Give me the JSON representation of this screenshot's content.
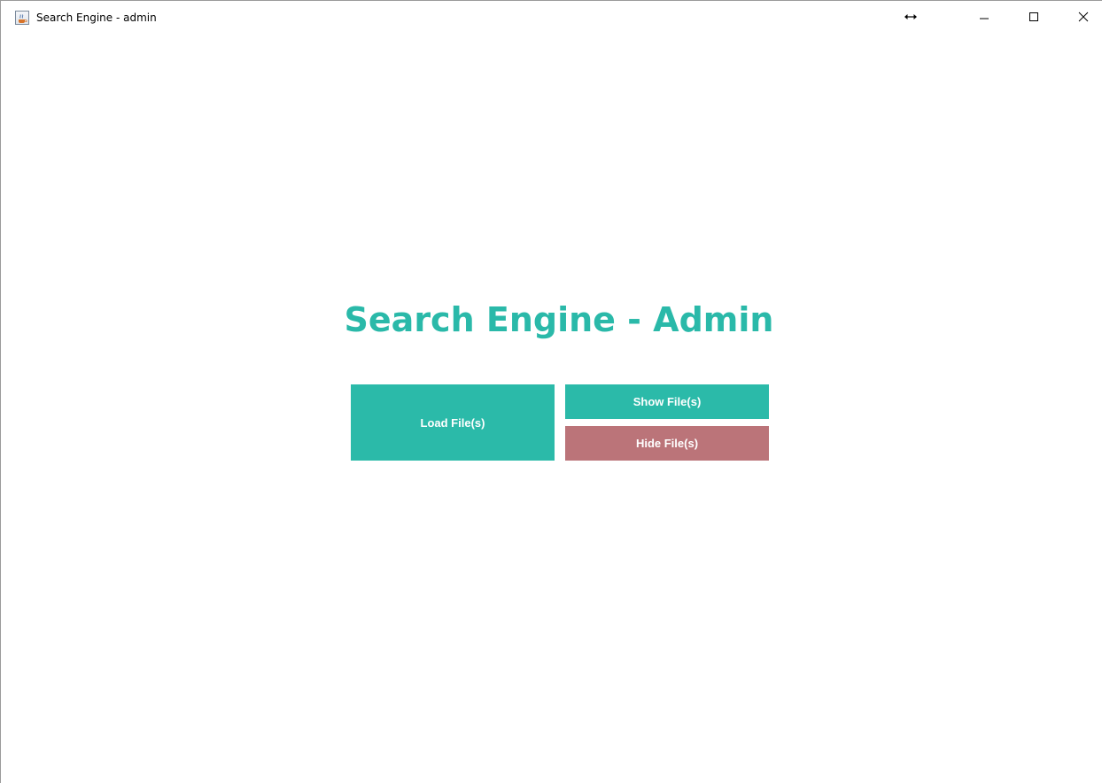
{
  "window": {
    "title": "Search Engine - admin",
    "icon": "java-cup-icon",
    "controls": {
      "resize_icon": "horizontal-resize-icon",
      "minimize_icon": "minimize-icon",
      "maximize_icon": "maximize-icon",
      "close_icon": "close-icon"
    }
  },
  "main": {
    "heading": "Search Engine - Admin",
    "buttons": {
      "load_label": "Load File(s)",
      "show_label": "Show File(s)",
      "hide_label": "Hide File(s)"
    }
  },
  "colors": {
    "accent": "#2bbaa9",
    "heading": "#2ab9a9",
    "hide_button": "#bb7479",
    "button_text": "#ffffff",
    "background": "#ffffff"
  }
}
